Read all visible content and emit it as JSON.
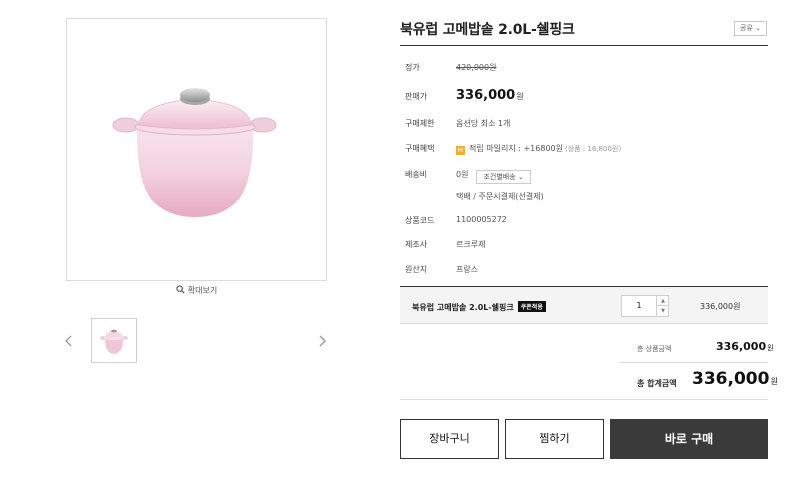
{
  "product": {
    "title": "북유럽 고메밥솥 2.0L-쉘핑크",
    "share_label": "공유 ⌄",
    "image_alt": "pot-image"
  },
  "gallery": {
    "zoom_label": "확대보기"
  },
  "info": {
    "list_price_label": "정가",
    "list_price": "420,000원",
    "sale_price_label": "판매가",
    "sale_price": "336,000",
    "sale_price_unit": "원",
    "purchase_limit_label": "구매제한",
    "purchase_limit": "옵션당 최소 1개",
    "benefit_label": "구매혜택",
    "benefit_text": "적립 마일리지 : +16800원",
    "benefit_note": "(상품 : 16,800원)",
    "shipping_label": "배송비",
    "shipping_fee": "0원",
    "shipping_select": "조건별배송 ⌄",
    "shipping_method": "택배 / 주문시결제(선결제)",
    "code_label": "상품코드",
    "code": "1100005272",
    "maker_label": "제조사",
    "maker": "르크루제",
    "origin_label": "원산지",
    "origin": "프랑스"
  },
  "option": {
    "name": "북유럽 고메밥솥 2.0L-쉘핑크",
    "coupon_badge": "쿠폰적용",
    "quantity": "1",
    "price": "336,000원"
  },
  "totals": {
    "subtotal_label": "총 상품금액",
    "subtotal": "336,000",
    "subtotal_unit": "원",
    "total_label": "총 합계금액",
    "total": "336,000",
    "total_unit": "원"
  },
  "buttons": {
    "cart": "장바구니",
    "wish": "찜하기",
    "buy": "바로 구매"
  },
  "colors": {
    "pot_pink": "#f1c9d8",
    "buy_button": "#3a3a3a",
    "mileage_badge": "#e8b130"
  }
}
